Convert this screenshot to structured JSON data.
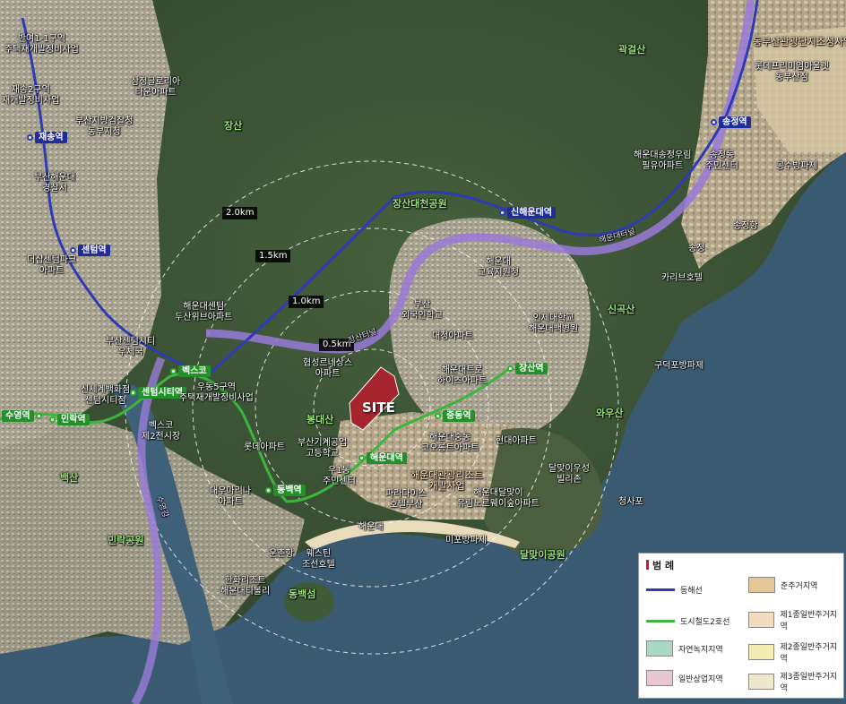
{
  "map": {
    "site_label": "SITE",
    "distance_rings": [
      "0.5km",
      "1.0km",
      "1.5km",
      "2.0km"
    ],
    "mountains": [
      "장산",
      "곽걸산",
      "신곡산",
      "봉대산",
      "와우산",
      "백산"
    ],
    "parks": [
      "장산대천공원",
      "민락공원",
      "동백섬",
      "달맞이공원"
    ],
    "stations_blue": [
      "재송역",
      "센텀역",
      "신해운대역",
      "송정역"
    ],
    "stations_green": [
      "수영역",
      "민락역",
      "센텀시티역",
      "벡스코",
      "동백역",
      "해운대역",
      "중동역",
      "장산역"
    ],
    "roads": [
      "해운대터널",
      "장산터널",
      "수영강",
      "청사포",
      "송정",
      "해운대",
      "운촌항"
    ],
    "places": [
      "반여1-1구역\n주택재개발정비사업",
      "삼정글로리아\n타운아파트",
      "재송2구역\n재개발정비사업",
      "부산지방검찰청\n동부지청",
      "부산해운대\n경찰서",
      "더샵센텀파크\n아파트",
      "부산센텀시티\n우체국",
      "신세계백화점\n센텀시티점",
      "벡스코\n제2전시장",
      "해운대센텀\n두산위브아파트",
      "우동5구역\n주택재개발정비사업",
      "협성르네상스\n아파트",
      "부산\n외국인학교",
      "대청아파트",
      "해운대\n교육지원청",
      "인제대학교\n해운대백병원",
      "해운대트로\n하이츠아파트",
      "롯데아파트",
      "부산기계공업\n고등학교",
      "우1동\n주민센터",
      "대우마리나\n아파트",
      "해운대중동\n코오롱트아파트",
      "현대아파트",
      "해운대관광리조트\n개발사업",
      "파라다이스\n호텔부산",
      "해운대달맞이\n유림노르웨이숲아파트",
      "달맞이우성\n빌리존",
      "미포방파제",
      "웨스틴\n조선호텔",
      "한화리조트\n해운대티볼리",
      "해운대송정우림\n필유아파트",
      "송정동\n주민센터",
      "구덕포방파제",
      "카리브호텔",
      "공수방파제",
      "동부산관광단지조성사업",
      "롯데프리미엄아울렛\n동부산점",
      "송정항"
    ]
  },
  "legend": {
    "title": "범 례",
    "items": [
      {
        "label": "동해선",
        "type": "line",
        "color": "#2e3bb5"
      },
      {
        "label": "준주거지역",
        "type": "box",
        "color": "#e6c79a"
      },
      {
        "label": "도시철도2호선",
        "type": "line",
        "color": "#3bb53b"
      },
      {
        "label": "제1종일반주거지역",
        "type": "box",
        "color": "#f2dcc0"
      },
      {
        "label": "자연녹지지역",
        "type": "box",
        "color": "#a9d9c2"
      },
      {
        "label": "제2종일반주거지역",
        "type": "box",
        "color": "#f3ecb4"
      },
      {
        "label": "일반상업지역",
        "type": "box",
        "color": "#e9c6d2"
      },
      {
        "label": "제3종일반주거지역",
        "type": "box",
        "color": "#eee9cc"
      }
    ]
  },
  "colors": {
    "donghae_line": "#2e3bb5",
    "subway_line2": "#3bb53b",
    "road_tunnel": "#9a7ad8",
    "site": "#a5242d"
  }
}
